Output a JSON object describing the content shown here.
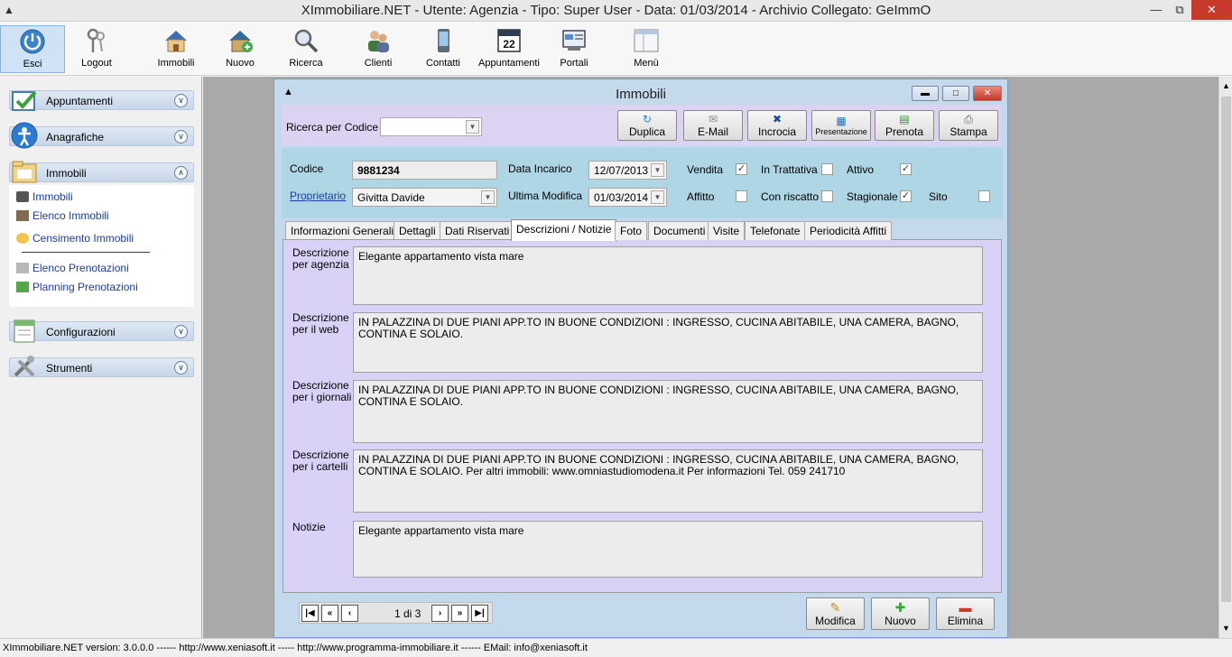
{
  "window": {
    "title": "XImmobiliare.NET - Utente: Agenzia - Tipo: Super User - Data: 01/03/2014 - Archivio Collegato: GeImmO"
  },
  "toolbar": [
    {
      "label": "Esci",
      "icon": "power-icon"
    },
    {
      "label": "Logout",
      "icon": "keys-icon"
    },
    {
      "label": "Immobili",
      "icon": "house-icon"
    },
    {
      "label": "Nuovo",
      "icon": "new-house-icon"
    },
    {
      "label": "Ricerca",
      "icon": "magnifier-icon"
    },
    {
      "label": "Clienti",
      "icon": "people-icon"
    },
    {
      "label": "Contatti",
      "icon": "phone-icon"
    },
    {
      "label": "Appuntamenti",
      "icon": "calendar-icon"
    },
    {
      "label": "Portali",
      "icon": "portal-icon"
    },
    {
      "label": "Menù",
      "icon": "window-icon"
    }
  ],
  "calendar_day": "22",
  "sidebar": {
    "sections": [
      "Appuntamenti",
      "Anagrafiche",
      "Immobili",
      "Configurazioni",
      "Strumenti"
    ],
    "immobili_items": [
      "Immobili",
      "Elenco Immobili",
      "Censimento Immobili",
      "Elenco Prenotazioni",
      "Planning Prenotazioni"
    ]
  },
  "form": {
    "title": "Immobili",
    "search_label": "Ricerca per Codice",
    "search_value": "",
    "buttons": [
      "Duplica",
      "E-Mail",
      "Incrocia",
      "Presentazione",
      "Prenota",
      "Stampa"
    ],
    "codice_label": "Codice",
    "codice": "9881234",
    "proprietario_label": "Proprietario",
    "proprietario": "Givitta Davide",
    "data_incarico_label": "Data Incarico",
    "data_incarico": "12/07/2013",
    "ultima_modifica_label": "Ultima Modifica",
    "ultima_modifica": "01/03/2014",
    "checks": [
      {
        "label": "Vendita",
        "checked": true
      },
      {
        "label": "In Trattativa",
        "checked": false
      },
      {
        "label": "Attivo",
        "checked": true
      },
      {
        "label": "Affitto",
        "checked": false
      },
      {
        "label": "Con riscatto",
        "checked": false
      },
      {
        "label": "Stagionale",
        "checked": true
      },
      {
        "label": "Sito",
        "checked": false
      }
    ],
    "tabs": [
      "Informazioni Generali",
      "Dettagli",
      "Dati Riservati",
      "Descrizioni / Notizie",
      "Foto",
      "Documenti",
      "Visite",
      "Telefonate",
      "Periodicità Affitti"
    ],
    "selected_tab": 3,
    "descriptions": [
      {
        "label1": "Descrizione",
        "label2": "per agenzia",
        "text": "Elegante appartamento vista mare"
      },
      {
        "label1": "Descrizione",
        "label2": "per il web",
        "text": "IN PALAZZINA DI DUE PIANI APP.TO IN BUONE CONDIZIONI : INGRESSO, CUCINA ABITABILE, UNA CAMERA, BAGNO, CONTINA E SOLAIO."
      },
      {
        "label1": "Descrizione",
        "label2": "per i giornali",
        "text": "IN PALAZZINA DI DUE PIANI APP.TO IN BUONE CONDIZIONI : INGRESSO, CUCINA ABITABILE, UNA CAMERA, BAGNO, CONTINA E SOLAIO."
      },
      {
        "label1": "Descrizione",
        "label2": "per i cartelli",
        "text": "IN PALAZZINA DI DUE PIANI APP.TO IN BUONE CONDIZIONI : INGRESSO, CUCINA ABITABILE, UNA CAMERA, BAGNO, CONTINA E SOLAIO. Per altri immobili: www.omniastudiomodena.it Per informazioni Tel. 059 241710"
      },
      {
        "label1": "Notizie",
        "label2": "",
        "text": "Elegante appartamento vista mare"
      }
    ],
    "record_position": "1 di 3",
    "bottom_buttons": [
      "Modifica",
      "Nuovo",
      "Elimina"
    ]
  },
  "status": "XImmobiliare.NET version: 3.0.0.0 ------ http://www.xeniasoft.it ----- http://www.programma-immobiliare.it ------ EMail: info@xeniasoft.it",
  "colors": {
    "accent": "#cfe2f6",
    "tabpanel": "#d9d2f6",
    "info_panel": "#aed6e4",
    "top_panel": "#dcd3f3",
    "close": "#c7392b"
  }
}
